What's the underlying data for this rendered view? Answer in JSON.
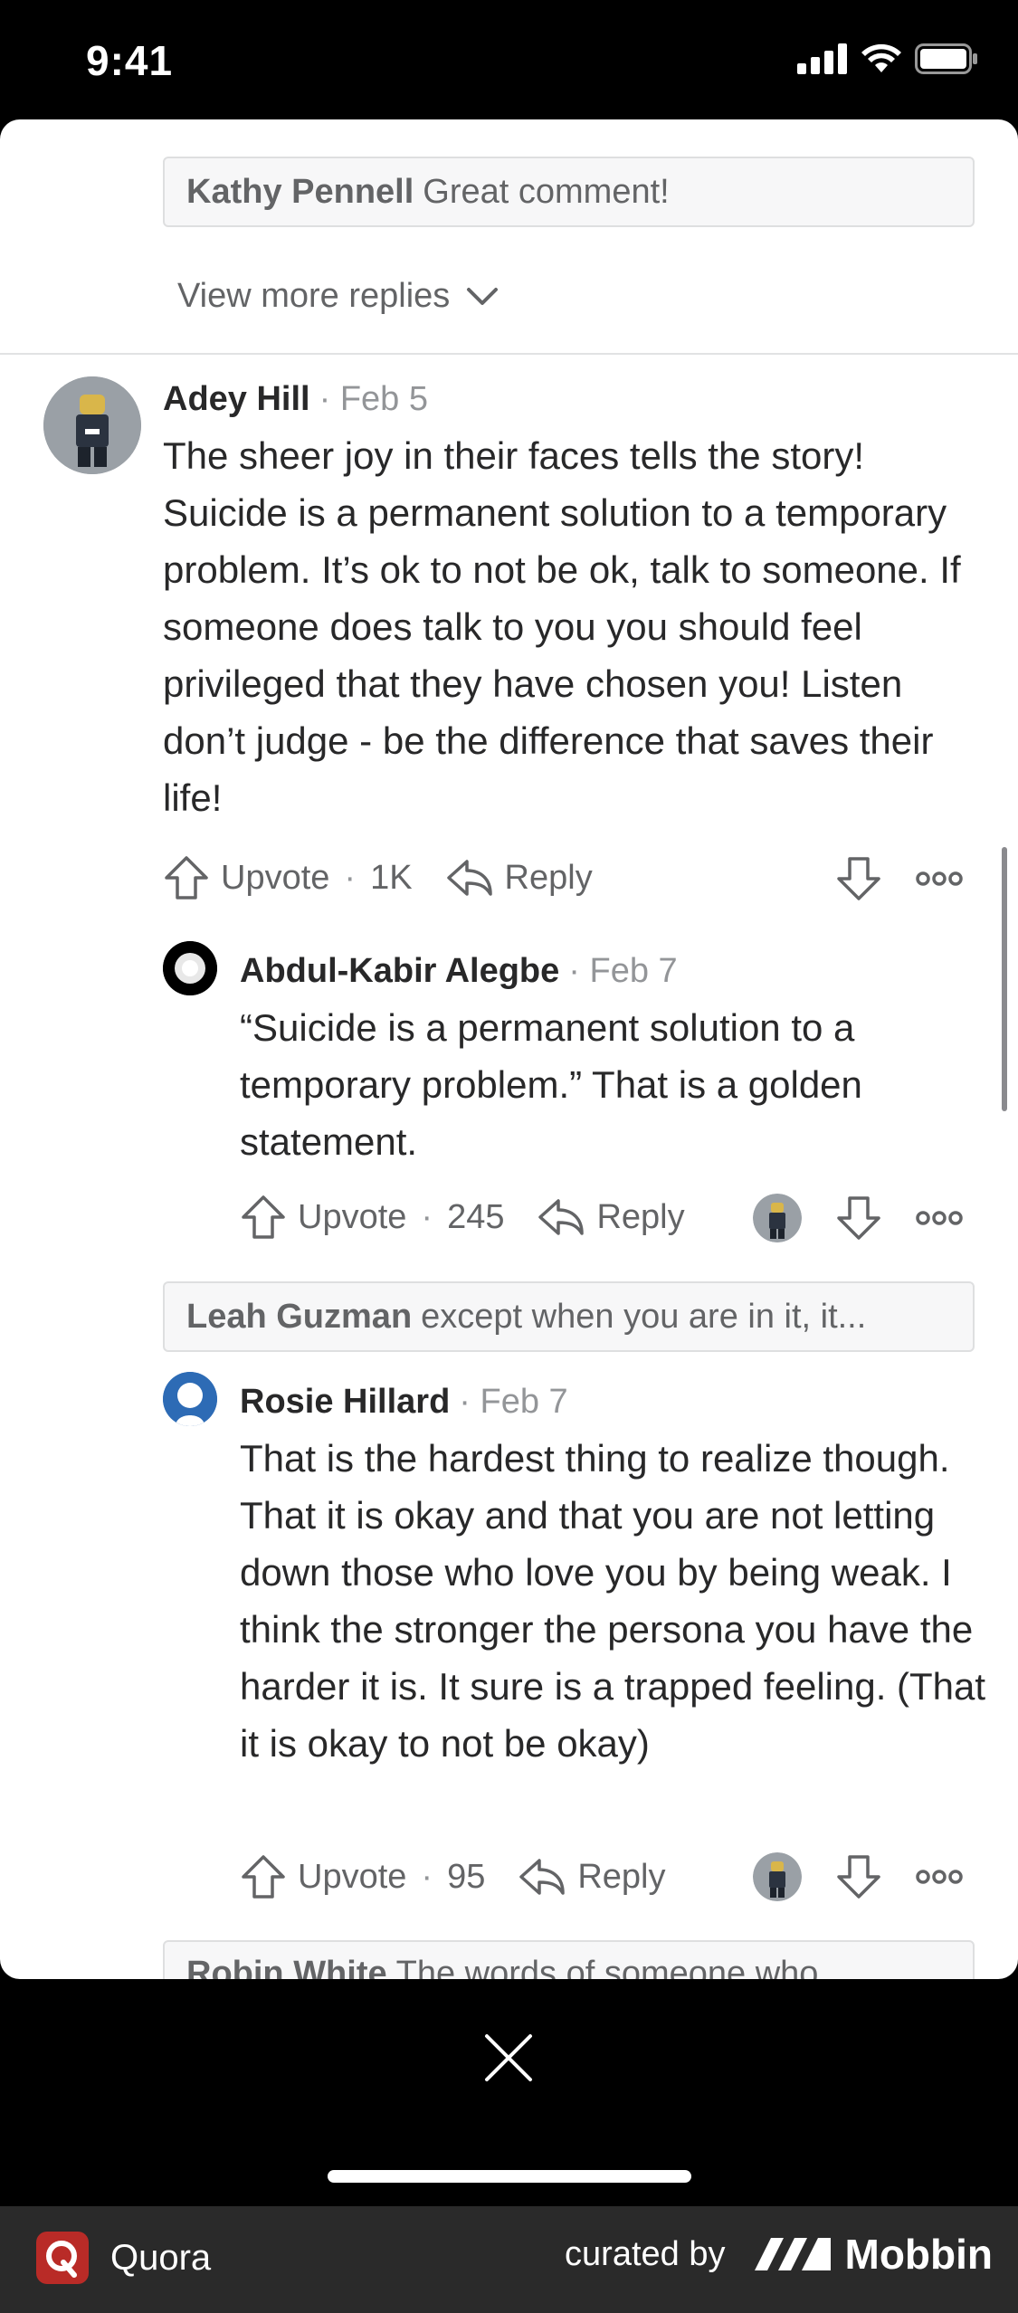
{
  "status_bar": {
    "time": "9:41"
  },
  "top_reply": {
    "name": "Kathy Pennell",
    "text": "Great comment!"
  },
  "view_more": {
    "label": "View more replies"
  },
  "comments": [
    {
      "name": "Adey Hill",
      "date": "· Feb 5",
      "body": "The sheer joy in their faces tells the story! Suicide is a permanent solution to a temporary problem. It’s ok to not be ok, talk to someone. If someone does talk to you you should feel privileged that they have chosen you! Listen don’t judge - be the difference that saves their life!",
      "upvote_label": "Upvote",
      "upvote_count": "1K",
      "reply_label": "Reply"
    },
    {
      "name": "Abdul-Kabir Alegbe",
      "date": "· Feb 7",
      "body": "“Suicide is a permanent solution to a temporary problem.” That is a golden statement.",
      "upvote_label": "Upvote",
      "upvote_count": "245",
      "reply_label": "Reply"
    },
    {
      "name": "Rosie Hillard",
      "date": "· Feb 7",
      "body": "That is the hardest thing to realize though. That it is okay and that you are not letting down those who love you by being weak. I think the stronger the persona you have the harder it is. It sure is a trapped feeling. (That it is okay to not be okay)",
      "upvote_label": "Upvote",
      "upvote_count": "95",
      "reply_label": "Reply"
    }
  ],
  "reply_previews": [
    {
      "name": "Leah Guzman",
      "text": "except when you are in it, it..."
    },
    {
      "name": "Robin White",
      "text": "The words of someone who"
    }
  ],
  "footer": {
    "brand": "Quora",
    "curated_by": "curated by",
    "mobbin": "Mobbin"
  },
  "colors": {
    "quora_red": "#b92b27",
    "text": "#282829",
    "muted": "#636466"
  }
}
